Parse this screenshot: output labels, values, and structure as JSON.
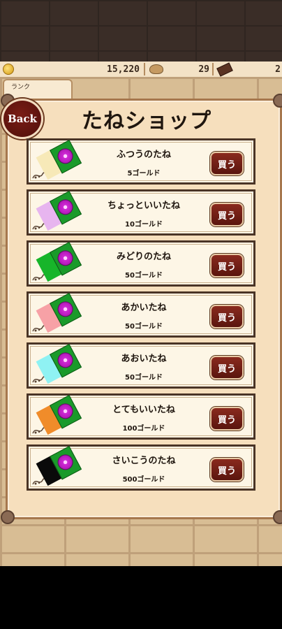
{
  "status": {
    "gold": "15,220",
    "seeds": "29",
    "chocolate": "2"
  },
  "rank_tab": "ランク",
  "back_label": "Back",
  "title": "たねショップ",
  "items": [
    {
      "name": "ふつうのたね",
      "price": "5ゴールド",
      "buy": "買う",
      "color": "#f7e9b8"
    },
    {
      "name": "ちょっといいたね",
      "price": "10ゴールド",
      "buy": "買う",
      "color": "#e7b5ef"
    },
    {
      "name": "みどりのたね",
      "price": "50ゴールド",
      "buy": "買う",
      "color": "#17b52a"
    },
    {
      "name": "あかいたね",
      "price": "50ゴールド",
      "buy": "買う",
      "color": "#f7a1a6"
    },
    {
      "name": "あおいたね",
      "price": "50ゴールド",
      "buy": "買う",
      "color": "#8ff2f3"
    },
    {
      "name": "とてもいいたね",
      "price": "100ゴールド",
      "buy": "買う",
      "color": "#f08c2a"
    },
    {
      "name": "さいこうのたね",
      "price": "500ゴールド",
      "buy": "買う",
      "color": "#0a0a0a"
    }
  ]
}
